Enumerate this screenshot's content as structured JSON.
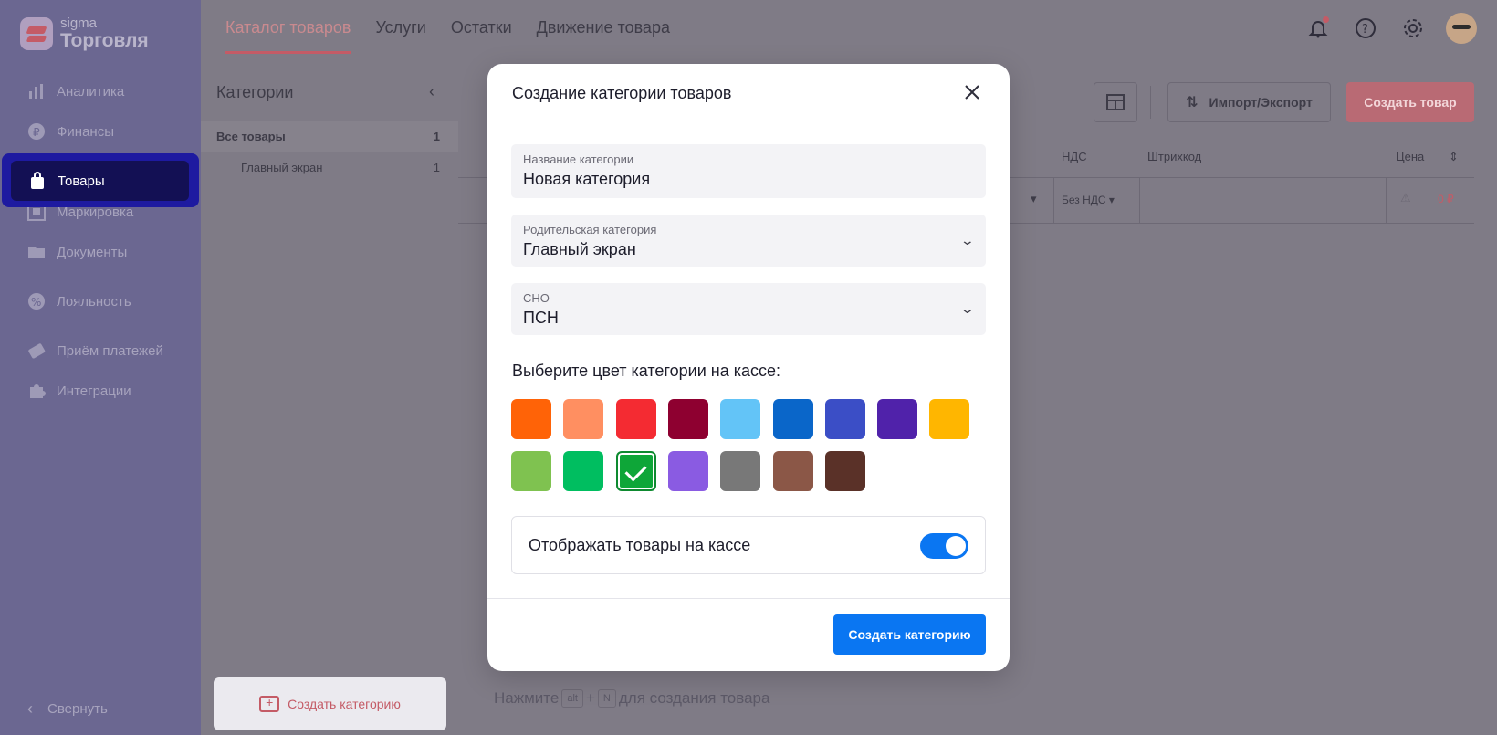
{
  "app": {
    "logo_small": "sigma",
    "logo_big": "Торговля"
  },
  "sidebar": {
    "items": [
      {
        "label": "Аналитика",
        "icon": "chart-icon"
      },
      {
        "label": "Финансы",
        "icon": "ruble-icon"
      },
      {
        "label": "Товары",
        "icon": "bag-icon",
        "active": true
      },
      {
        "label": "Маркировка",
        "icon": "qr-icon"
      },
      {
        "label": "Документы",
        "icon": "folder-icon"
      },
      {
        "label": "Лояльность",
        "icon": "percent-icon"
      },
      {
        "label": "Приём платежей",
        "icon": "card-icon"
      },
      {
        "label": "Интеграции",
        "icon": "puzzle-icon"
      }
    ],
    "collapse_label": "Свернуть"
  },
  "topbar": {
    "tabs": [
      {
        "label": "Каталог товаров",
        "active": true
      },
      {
        "label": "Услуги"
      },
      {
        "label": "Остатки"
      },
      {
        "label": "Движение товара"
      }
    ]
  },
  "categories": {
    "title": "Категории",
    "all": {
      "label": "Все товары",
      "count": "1"
    },
    "items": [
      {
        "label": "Главный экран",
        "count": "1"
      }
    ],
    "create_label": "Создать категорию"
  },
  "main": {
    "import_label": "Импорт/Экспорт",
    "create_product_label": "Создать товар",
    "columns": {
      "nds": "НДС",
      "barcode": "Штрихкод",
      "price": "Цена"
    },
    "row": {
      "nds": "Без НДС",
      "price": "0 ₽"
    },
    "hint": {
      "prefix": "Нажмите",
      "key1": "alt",
      "plus": "+",
      "key2": "N",
      "suffix": "для создания товара"
    }
  },
  "modal": {
    "title": "Создание категории товаров",
    "name_field": {
      "label": "Название категории",
      "value": "Новая категория"
    },
    "parent_field": {
      "label": "Родительская категория",
      "value": "Главный экран"
    },
    "tax_field": {
      "label": "СНО",
      "value": "ПСН"
    },
    "color_title": "Выберите цвет категории на кассе:",
    "colors": [
      "#ff6307",
      "#ff8f61",
      "#f42b32",
      "#8e0030",
      "#63c4f7",
      "#0a66c9",
      "#3b4ec6",
      "#5022aa",
      "#ffb600",
      "#7fc250",
      "#00be60",
      "#0ea638",
      "#8a5be2",
      "#787878",
      "#8b5747",
      "#5a3128"
    ],
    "selected_color_index": 11,
    "toggle_label": "Отображать товары на кассе",
    "toggle_on": true,
    "submit_label": "Создать категорию"
  }
}
